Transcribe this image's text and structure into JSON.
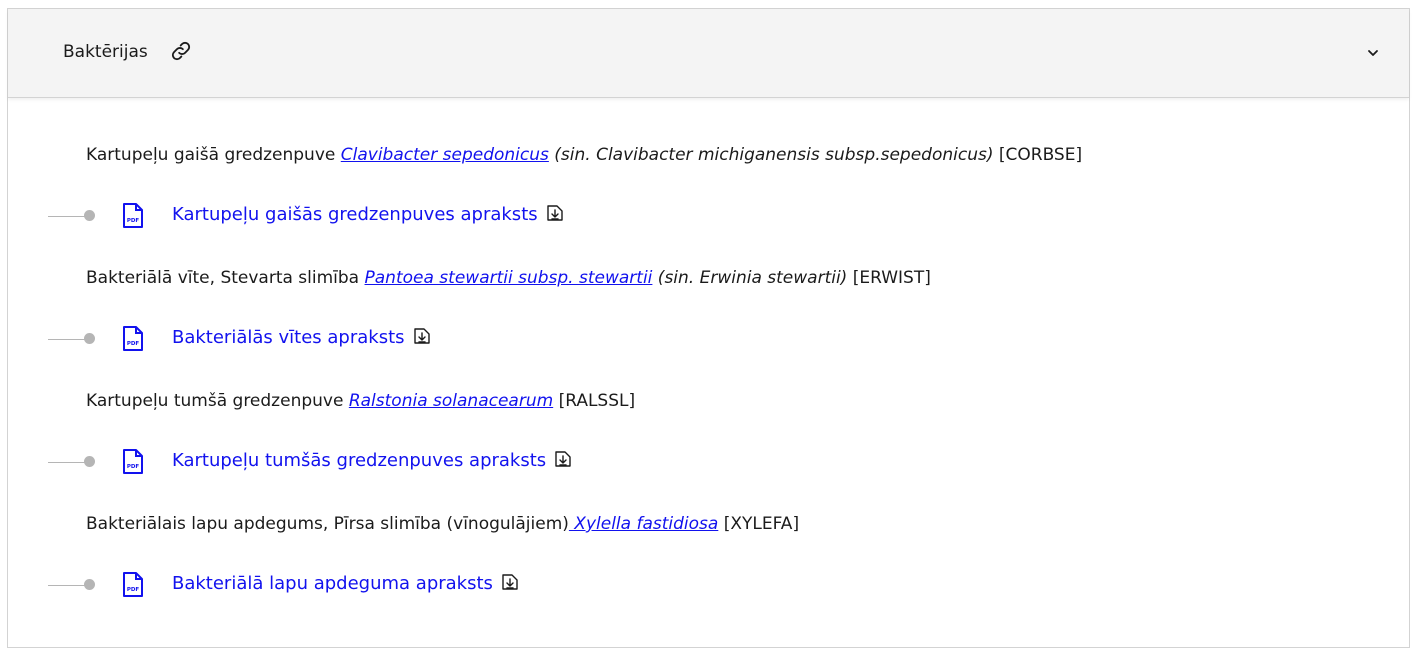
{
  "accordion": {
    "title": "Baktērijas",
    "link_icon": "link-icon",
    "toggle_icon": "chevron-down-icon"
  },
  "entries": [
    {
      "prefix": "Kartupeļu gaišā gredzenpuve ",
      "link": "Clavibacter sepedonicus",
      "synonym": " (sin. Clavibacter michiganensis subsp.sepedonicus)",
      "code": " [CORBSE]",
      "doc": "Kartupeļu gaišās gredzenpuves apraksts"
    },
    {
      "prefix": "Bakteriālā vīte, Stevarta slimība ",
      "link": "Pantoea stewartii subsp. stewartii",
      "synonym": " (sin. Erwinia stewartii)",
      "code": " [ERWIST]",
      "doc": "Bakteriālās vītes apraksts"
    },
    {
      "prefix": "Kartupeļu tumšā gredzenpuve ",
      "link": "Ralstonia solanacearum",
      "synonym": "",
      "code": " [RALSSL]",
      "doc": "Kartupeļu tumšās gredzenpuves apraksts"
    },
    {
      "prefix": "Bakteriālais lapu apdegums, Pīrsa slimība (vīnogulājiem)",
      "link": " Xylella fastidiosa",
      "synonym": "",
      "code": " [XYLEFA]",
      "doc": "Bakteriālā lapu apdeguma apraksts"
    }
  ],
  "icons": {
    "pdf": "pdf-file-icon",
    "download": "download-icon"
  },
  "colors": {
    "link": "#1212ee",
    "header_bg": "#f4f4f4",
    "border": "#d3d3d3",
    "bullet": "#b5b5b5"
  }
}
